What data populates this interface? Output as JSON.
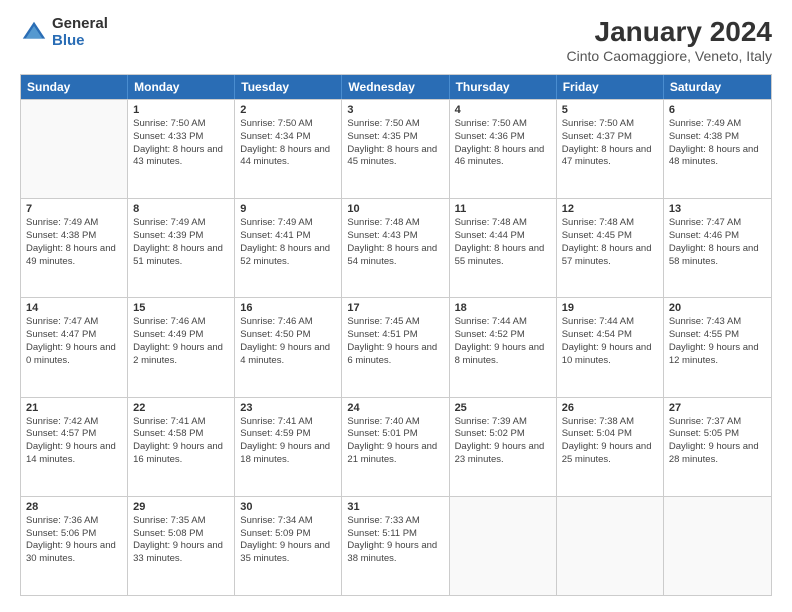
{
  "logo": {
    "general": "General",
    "blue": "Blue"
  },
  "title": "January 2024",
  "subtitle": "Cinto Caomaggiore, Veneto, Italy",
  "days": [
    "Sunday",
    "Monday",
    "Tuesday",
    "Wednesday",
    "Thursday",
    "Friday",
    "Saturday"
  ],
  "weeks": [
    [
      {
        "day": "",
        "sunrise": "",
        "sunset": "",
        "daylight": ""
      },
      {
        "day": "1",
        "sunrise": "Sunrise: 7:50 AM",
        "sunset": "Sunset: 4:33 PM",
        "daylight": "Daylight: 8 hours and 43 minutes."
      },
      {
        "day": "2",
        "sunrise": "Sunrise: 7:50 AM",
        "sunset": "Sunset: 4:34 PM",
        "daylight": "Daylight: 8 hours and 44 minutes."
      },
      {
        "day": "3",
        "sunrise": "Sunrise: 7:50 AM",
        "sunset": "Sunset: 4:35 PM",
        "daylight": "Daylight: 8 hours and 45 minutes."
      },
      {
        "day": "4",
        "sunrise": "Sunrise: 7:50 AM",
        "sunset": "Sunset: 4:36 PM",
        "daylight": "Daylight: 8 hours and 46 minutes."
      },
      {
        "day": "5",
        "sunrise": "Sunrise: 7:50 AM",
        "sunset": "Sunset: 4:37 PM",
        "daylight": "Daylight: 8 hours and 47 minutes."
      },
      {
        "day": "6",
        "sunrise": "Sunrise: 7:49 AM",
        "sunset": "Sunset: 4:38 PM",
        "daylight": "Daylight: 8 hours and 48 minutes."
      }
    ],
    [
      {
        "day": "7",
        "sunrise": "Sunrise: 7:49 AM",
        "sunset": "Sunset: 4:38 PM",
        "daylight": "Daylight: 8 hours and 49 minutes."
      },
      {
        "day": "8",
        "sunrise": "Sunrise: 7:49 AM",
        "sunset": "Sunset: 4:39 PM",
        "daylight": "Daylight: 8 hours and 51 minutes."
      },
      {
        "day": "9",
        "sunrise": "Sunrise: 7:49 AM",
        "sunset": "Sunset: 4:41 PM",
        "daylight": "Daylight: 8 hours and 52 minutes."
      },
      {
        "day": "10",
        "sunrise": "Sunrise: 7:48 AM",
        "sunset": "Sunset: 4:43 PM",
        "daylight": "Daylight: 8 hours and 54 minutes."
      },
      {
        "day": "11",
        "sunrise": "Sunrise: 7:48 AM",
        "sunset": "Sunset: 4:44 PM",
        "daylight": "Daylight: 8 hours and 55 minutes."
      },
      {
        "day": "12",
        "sunrise": "Sunrise: 7:48 AM",
        "sunset": "Sunset: 4:45 PM",
        "daylight": "Daylight: 8 hours and 57 minutes."
      },
      {
        "day": "13",
        "sunrise": "Sunrise: 7:47 AM",
        "sunset": "Sunset: 4:46 PM",
        "daylight": "Daylight: 8 hours and 58 minutes."
      }
    ],
    [
      {
        "day": "14",
        "sunrise": "Sunrise: 7:47 AM",
        "sunset": "Sunset: 4:47 PM",
        "daylight": "Daylight: 9 hours and 0 minutes."
      },
      {
        "day": "15",
        "sunrise": "Sunrise: 7:46 AM",
        "sunset": "Sunset: 4:49 PM",
        "daylight": "Daylight: 9 hours and 2 minutes."
      },
      {
        "day": "16",
        "sunrise": "Sunrise: 7:46 AM",
        "sunset": "Sunset: 4:50 PM",
        "daylight": "Daylight: 9 hours and 4 minutes."
      },
      {
        "day": "17",
        "sunrise": "Sunrise: 7:45 AM",
        "sunset": "Sunset: 4:51 PM",
        "daylight": "Daylight: 9 hours and 6 minutes."
      },
      {
        "day": "18",
        "sunrise": "Sunrise: 7:44 AM",
        "sunset": "Sunset: 4:52 PM",
        "daylight": "Daylight: 9 hours and 8 minutes."
      },
      {
        "day": "19",
        "sunrise": "Sunrise: 7:44 AM",
        "sunset": "Sunset: 4:54 PM",
        "daylight": "Daylight: 9 hours and 10 minutes."
      },
      {
        "day": "20",
        "sunrise": "Sunrise: 7:43 AM",
        "sunset": "Sunset: 4:55 PM",
        "daylight": "Daylight: 9 hours and 12 minutes."
      }
    ],
    [
      {
        "day": "21",
        "sunrise": "Sunrise: 7:42 AM",
        "sunset": "Sunset: 4:57 PM",
        "daylight": "Daylight: 9 hours and 14 minutes."
      },
      {
        "day": "22",
        "sunrise": "Sunrise: 7:41 AM",
        "sunset": "Sunset: 4:58 PM",
        "daylight": "Daylight: 9 hours and 16 minutes."
      },
      {
        "day": "23",
        "sunrise": "Sunrise: 7:41 AM",
        "sunset": "Sunset: 4:59 PM",
        "daylight": "Daylight: 9 hours and 18 minutes."
      },
      {
        "day": "24",
        "sunrise": "Sunrise: 7:40 AM",
        "sunset": "Sunset: 5:01 PM",
        "daylight": "Daylight: 9 hours and 21 minutes."
      },
      {
        "day": "25",
        "sunrise": "Sunrise: 7:39 AM",
        "sunset": "Sunset: 5:02 PM",
        "daylight": "Daylight: 9 hours and 23 minutes."
      },
      {
        "day": "26",
        "sunrise": "Sunrise: 7:38 AM",
        "sunset": "Sunset: 5:04 PM",
        "daylight": "Daylight: 9 hours and 25 minutes."
      },
      {
        "day": "27",
        "sunrise": "Sunrise: 7:37 AM",
        "sunset": "Sunset: 5:05 PM",
        "daylight": "Daylight: 9 hours and 28 minutes."
      }
    ],
    [
      {
        "day": "28",
        "sunrise": "Sunrise: 7:36 AM",
        "sunset": "Sunset: 5:06 PM",
        "daylight": "Daylight: 9 hours and 30 minutes."
      },
      {
        "day": "29",
        "sunrise": "Sunrise: 7:35 AM",
        "sunset": "Sunset: 5:08 PM",
        "daylight": "Daylight: 9 hours and 33 minutes."
      },
      {
        "day": "30",
        "sunrise": "Sunrise: 7:34 AM",
        "sunset": "Sunset: 5:09 PM",
        "daylight": "Daylight: 9 hours and 35 minutes."
      },
      {
        "day": "31",
        "sunrise": "Sunrise: 7:33 AM",
        "sunset": "Sunset: 5:11 PM",
        "daylight": "Daylight: 9 hours and 38 minutes."
      },
      {
        "day": "",
        "sunrise": "",
        "sunset": "",
        "daylight": ""
      },
      {
        "day": "",
        "sunrise": "",
        "sunset": "",
        "daylight": ""
      },
      {
        "day": "",
        "sunrise": "",
        "sunset": "",
        "daylight": ""
      }
    ]
  ]
}
